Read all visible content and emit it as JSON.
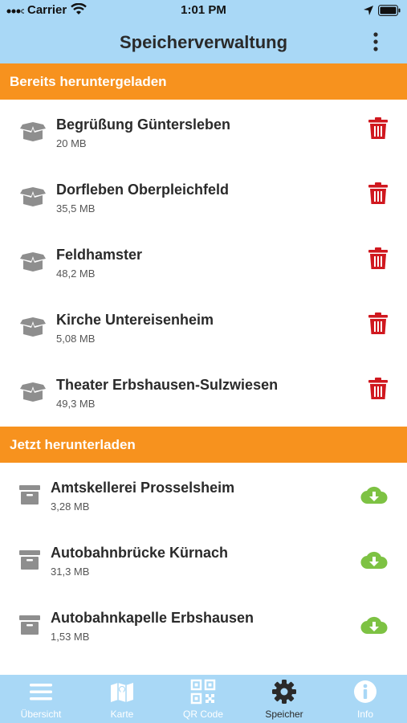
{
  "status": {
    "carrier": "Carrier",
    "time": "1:01 PM"
  },
  "header": {
    "title": "Speicherverwaltung"
  },
  "downloaded": {
    "heading": "Bereits heruntergeladen",
    "items": [
      {
        "name": "Begrüßung Güntersleben",
        "size": "20 MB"
      },
      {
        "name": "Dorfleben Oberpleichfeld",
        "size": "35,5 MB"
      },
      {
        "name": "Feldhamster",
        "size": "48,2 MB"
      },
      {
        "name": "Kirche Untereisenheim",
        "size": "5,08 MB"
      },
      {
        "name": "Theater Erbshausen-Sulzwiesen",
        "size": "49,3 MB"
      }
    ]
  },
  "available": {
    "heading": "Jetzt herunterladen",
    "items": [
      {
        "name": "Amtskellerei Prosselsheim",
        "size": "3,28 MB"
      },
      {
        "name": "Autobahnbrücke Kürnach",
        "size": "31,3 MB"
      },
      {
        "name": "Autobahnkapelle Erbshausen",
        "size": "1,53 MB"
      }
    ]
  },
  "tabs": [
    {
      "label": "Übersicht",
      "icon": "menu-icon"
    },
    {
      "label": "Karte",
      "icon": "map-icon"
    },
    {
      "label": "QR Code",
      "icon": "qr-code-icon"
    },
    {
      "label": "Speicher",
      "icon": "gear-icon"
    },
    {
      "label": "Info",
      "icon": "info-icon"
    }
  ],
  "colors": {
    "header": "#a9d8f6",
    "section": "#f7921e",
    "delete": "#d0181f",
    "download": "#7dc243",
    "icon": "#8e8e8e"
  }
}
